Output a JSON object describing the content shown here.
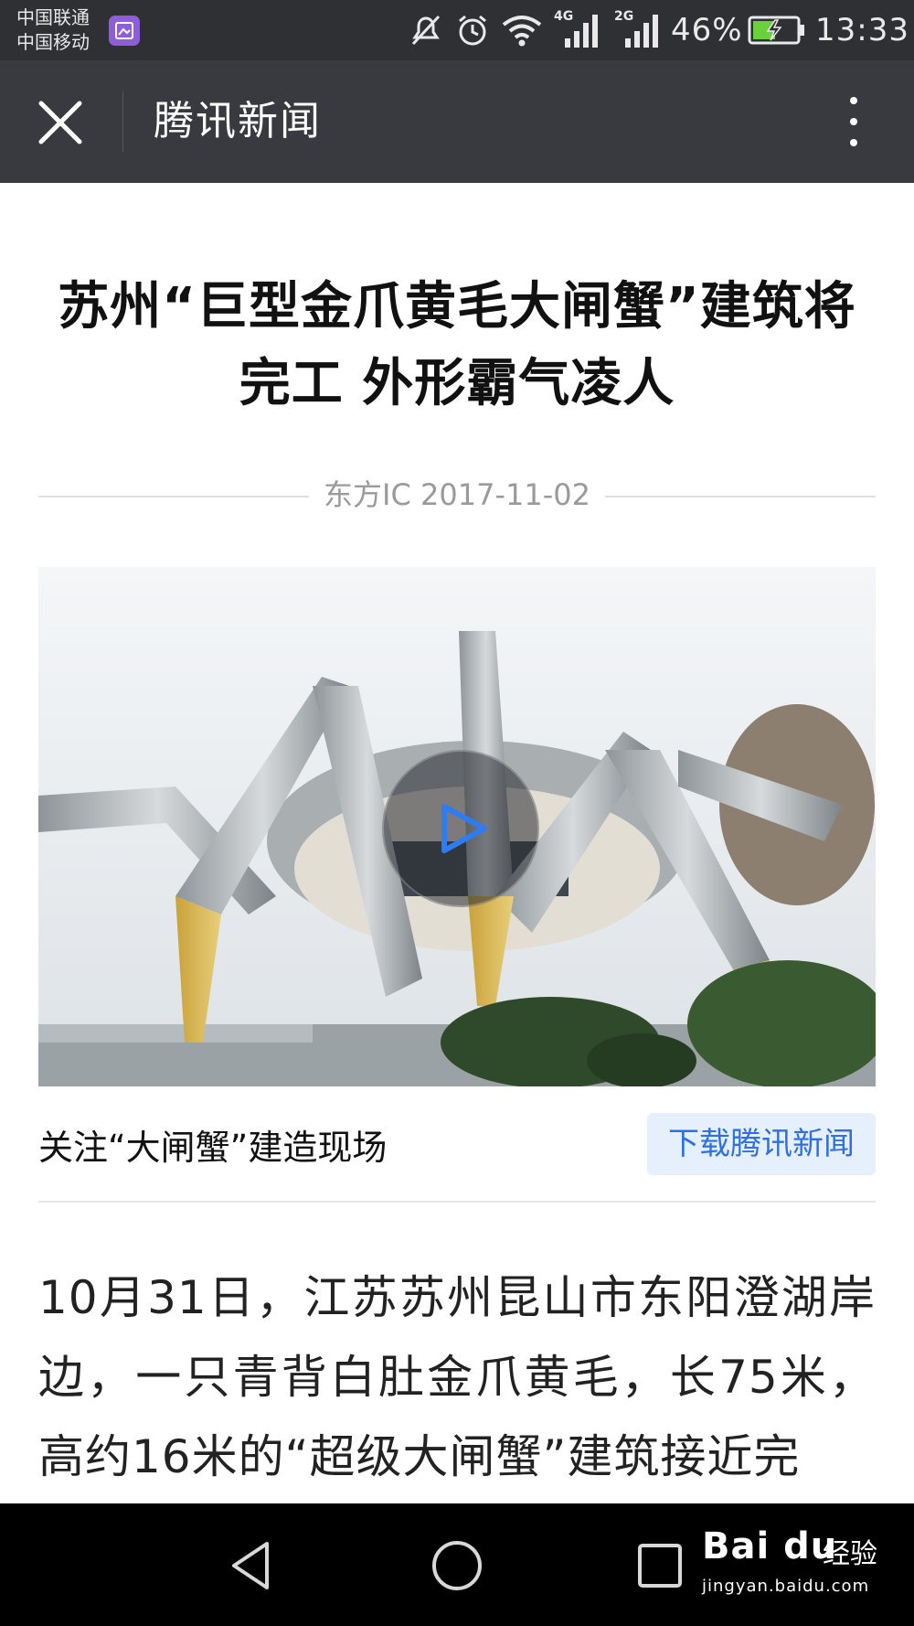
{
  "status_bar": {
    "carrier_1": "中国联通",
    "carrier_2": "中国移动",
    "network_1": "4G",
    "network_2": "2G",
    "battery_percent": "46%",
    "time": "13:33",
    "icons": [
      "gallery-notification-icon",
      "mute-icon",
      "alarm-icon",
      "wifi-icon",
      "signal-icon",
      "signal-icon",
      "battery-charging-icon"
    ]
  },
  "header": {
    "title": "腾讯新闻",
    "close_icon": "close-icon",
    "more_icon": "more-vertical-icon"
  },
  "article": {
    "headline": "苏州“巨型金爪黄毛大闸蟹”建筑将完工 外形霸气凌人",
    "source_date": "东方IC 2017-11-02",
    "video": {
      "play_icon": "play-icon",
      "caption": "关注“大闸蟹”建造现场"
    },
    "download_button": "下载腾讯新闻",
    "body": "10月31日，江苏苏州昆山市东阳澄湖岸边，一只青背白肚金爪黄毛，长75米，高约16米的“超级大闸蟹”建筑接近完"
  },
  "nav_bar": {
    "icons": [
      "back-icon",
      "home-icon",
      "recents-icon"
    ]
  },
  "watermark": {
    "logo": "Bai du",
    "suffix": "经验",
    "url": "jingyan.baidu.com"
  },
  "colors": {
    "status_bar": "#2f3033",
    "app_bar": "#393a3f",
    "accent_blue": "#2f6fe4",
    "button_bg": "#e6f0fd"
  }
}
